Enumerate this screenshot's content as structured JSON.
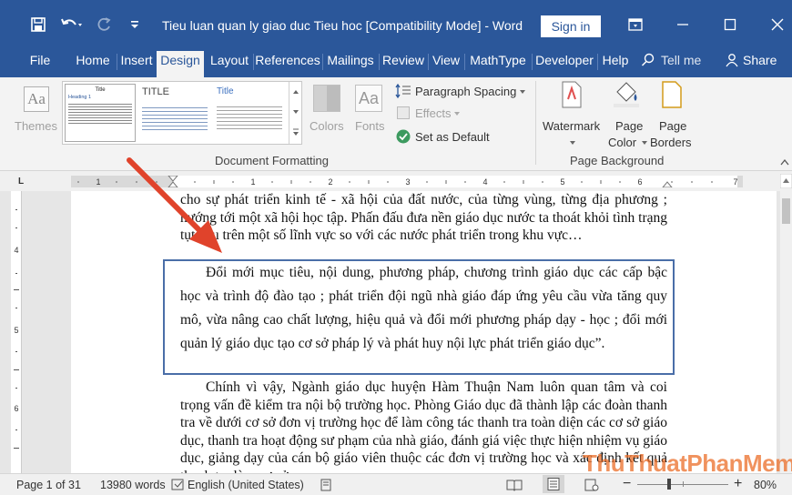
{
  "titlebar": {
    "doc_title": "Tieu luan quan ly giao duc Tieu hoc [Compatibility Mode]  -  Word",
    "sign_in": "Sign in",
    "bg_color": "#2b579a"
  },
  "tabs": [
    {
      "label": "File"
    },
    {
      "label": "Home"
    },
    {
      "label": "Insert"
    },
    {
      "label": "Design"
    },
    {
      "label": "Layout"
    },
    {
      "label": "References"
    },
    {
      "label": "Mailings"
    },
    {
      "label": "Review"
    },
    {
      "label": "View"
    },
    {
      "label": "MathType"
    },
    {
      "label": "Developer"
    },
    {
      "label": "Help"
    }
  ],
  "tell_me": "Tell me",
  "share": "Share",
  "ribbon": {
    "themes": "Themes",
    "style_title": "Title",
    "style_heading": "Heading 1",
    "style2_title": "TITLE",
    "style3_title": "Title",
    "colors": "Colors",
    "fonts": "Fonts",
    "paragraph_spacing": "Paragraph Spacing",
    "effects": "Effects",
    "set_as_default": "Set as Default",
    "document_formatting": "Document Formatting",
    "watermark": "Watermark",
    "page_color_1": "Page",
    "page_color_2": "Color",
    "page_borders_1": "Page",
    "page_borders_2": "Borders",
    "page_background": "Page Background"
  },
  "document": {
    "para1": "cho sự phát triển kinh tế - xã hội của đất nước, của từng vùng, từng địa phương ; hướng tới một xã hội học tập. Phấn đấu đưa nền giáo dục nước ta thoát khỏi tình trạng tụt hậu trên một số lĩnh vực so với các nước phát triển trong khu vực…",
    "para2": "Đổi mới mục tiêu, nội dung, phương pháp, chương trình giáo dục các cấp bậc học và trình độ đào tạo ; phát triển đội ngũ nhà giáo đáp ứng yêu cầu vừa tăng quy mô, vừa nâng cao chất lượng, hiệu quả và đổi mới phương pháp dạy - học ; đổi mới quản lý giáo dục tạo cơ sở pháp lý và phát huy nội lực phát triển giáo dục”.",
    "para3": "Chính vì vậy, Ngành giáo dục huyện Hàm Thuận Nam luôn quan tâm và coi trọng vấn đề kiểm tra nội bộ trường học. Phòng Giáo dục đã thành lập các đoàn thanh tra về dưới cơ sở đơn vị trường học để làm công tác thanh tra toàn diện các cơ sở giáo dục, thanh tra hoạt động sư phạm của nhà giáo, đánh giá việc thực hiện nhiệm vụ giáo dục, giảng dạy của cán bộ giáo viên thuộc các đơn vị trường học và xác định kết quả thanh tra làm cơ sở"
  },
  "status": {
    "page": "Page 1 of 31",
    "words": "13980 words",
    "language": "English (United States)",
    "zoom": "80%"
  },
  "watermark_text": "ThuThuatPhanMem.vn",
  "colors": {
    "accent": "#2b579a",
    "arrow": "#e0432b",
    "watermark": "#eb6e28"
  }
}
